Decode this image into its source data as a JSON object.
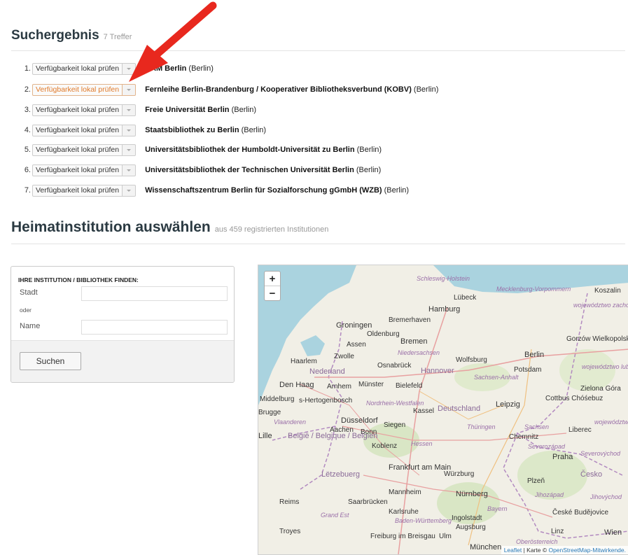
{
  "results": {
    "title": "Suchergebnis",
    "count": "7 Treffer",
    "button_label": "Verfügbarkeit lokal prüfen",
    "items": [
      {
        "num": "1.",
        "name": "RAM Berlin",
        "city": "(Berlin)"
      },
      {
        "num": "2.",
        "name": "Fernleihe Berlin-Brandenburg / Kooperativer Bibliotheksverbund (KOBV)",
        "city": "(Berlin)"
      },
      {
        "num": "3.",
        "name": "Freie Universität Berlin",
        "city": "(Berlin)"
      },
      {
        "num": "4.",
        "name": "Staatsbibliothek zu Berlin",
        "city": "(Berlin)"
      },
      {
        "num": "5.",
        "name": "Universitätsbibliothek der Humboldt-Universität zu Berlin",
        "city": "(Berlin)"
      },
      {
        "num": "6.",
        "name": "Universitätsbibliothek der Technischen Universität Berlin",
        "city": "(Berlin)"
      },
      {
        "num": "7.",
        "name": "Wissenschaftszentrum Berlin für Sozialforschung gGmbH (WZB)",
        "city": "(Berlin)"
      }
    ]
  },
  "home": {
    "title": "Heimatinstitution auswählen",
    "subtitle": "aus 459 registrierten Institutionen"
  },
  "finder": {
    "heading": "IHRE INSTITUTION / BIBLIOTHEK FINDEN:",
    "city_label": "Stadt",
    "or_label": "oder",
    "name_label": "Name",
    "city_value": "",
    "name_value": "",
    "search_button": "Suchen"
  },
  "map": {
    "zoom_in": "+",
    "zoom_out": "−",
    "attribution_leaflet": "Leaflet",
    "attribution_sep": " | Karte © ",
    "attribution_osm": "OpenStreetMap-Mitwirkende.",
    "labels": {
      "schleswig": "Schleswig-Holstein",
      "lubeck": "Lübeck",
      "mecklenburg": "Mecklenburg-Vorpommern",
      "koszalin": "Koszalin",
      "zachodnio": "województwo zachodniopomorskie",
      "hamburg": "Hamburg",
      "bremerhaven": "Bremerhaven",
      "groningen": "Groningen",
      "oldenburg": "Oldenburg",
      "bremen": "Bremen",
      "assen": "Assen",
      "zwolle": "Zwolle",
      "niedersachsen": "Niedersachsen",
      "wolfsburg": "Wolfsburg",
      "berlin": "Berlin",
      "gorzow": "Gorzów Wielkopolski",
      "haarlem": "Haarlem",
      "osnabruck": "Osnabrück",
      "nederland": "Nederland",
      "hannover": "Hannover",
      "potsdam": "Potsdam",
      "lubuskie": "województwo lubuskie",
      "denhaag": "Den Haag",
      "arnhem": "Arnhem",
      "munster": "Münster",
      "bielefeld": "Bielefeld",
      "sachsenanhalt": "Sachsen-Anhalt",
      "cottbus": "Cottbus Chóśebuz",
      "zielona": "Zielona Góra",
      "middelburg": "Middelburg",
      "hertogenbosch": "s-Hertogenbosch",
      "nordrhein": "Nordrhein-Westfalen",
      "kassel": "Kassel",
      "deutschland": "Deutschland",
      "leipzig": "Leipzig",
      "brugge": "Brugge",
      "vlaanderen": "Vlaanderen",
      "dusseldorf": "Düsseldorf",
      "siegen": "Siegen",
      "thuringen": "Thüringen",
      "sachsen": "Sachsen",
      "liberec": "Liberec",
      "dolnoslaskie": "województwo dolnośląskie",
      "aachen": "Aachen",
      "bonn": "Bonn",
      "chemnitz": "Chemnitz",
      "lille": "Lille",
      "belgie": "België / Belgique / Belgien",
      "koblenz": "Koblenz",
      "hessen": "Hessen",
      "severozapad": "Severozápad",
      "praha": "Praha",
      "severovychod": "Severovýchod",
      "frankfurt": "Frankfurt am Main",
      "letzebuerg": "Lëtzebuerg",
      "wurzburg": "Würzburg",
      "cesko": "Česko",
      "plzen": "Plzeň",
      "mannheim": "Mannheim",
      "nurnberg": "Nürnberg",
      "jihozapad": "Jihozápad",
      "jihovychod": "Jihovýchod",
      "reims": "Reims",
      "saarbrucken": "Saarbrücken",
      "karlsruhe": "Karlsruhe",
      "bayern": "Bayern",
      "grandest": "Grand Est",
      "badenw": "Baden-Württemberg",
      "ingolstadt": "Ingolstadt",
      "budejovice": "České Budějovice",
      "augsburg": "Augsburg",
      "troyes": "Troyes",
      "freiburg": "Freiburg im Breisgau",
      "ulm": "Ulm",
      "munchen": "München",
      "oberosterreich": "Oberösterreich",
      "linz": "Linz",
      "wien": "Wien"
    }
  },
  "colors": {
    "accent_orange": "#e07a2a",
    "arrow_red": "#e8281e",
    "water": "#aad3df"
  }
}
